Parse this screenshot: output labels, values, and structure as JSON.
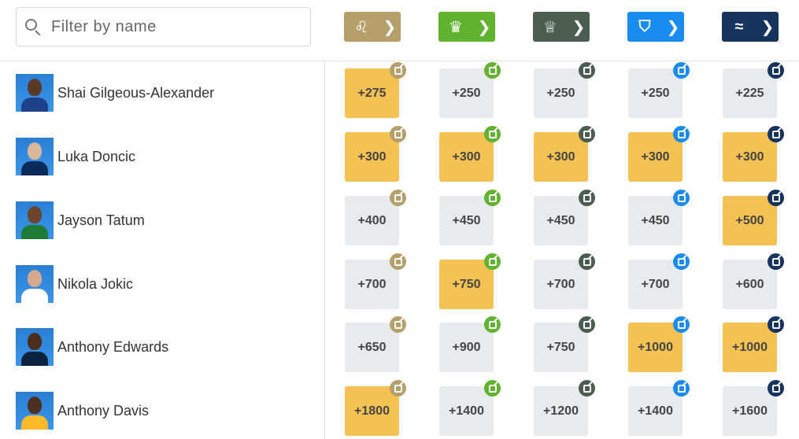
{
  "search": {
    "placeholder": "Filter by name",
    "value": ""
  },
  "books": [
    {
      "id": "betmgm",
      "color": "#b59f6b",
      "logo_icon": "lion-icon",
      "glyph": "♌"
    },
    {
      "id": "draftkings",
      "color": "#61b22e",
      "logo_icon": "crown-icon",
      "glyph": "♛"
    },
    {
      "id": "caesars",
      "color": "#4b5d50",
      "logo_icon": "trophy-icon",
      "glyph": "♕"
    },
    {
      "id": "fanduel",
      "color": "#1a8cf0",
      "logo_icon": "shield-icon",
      "glyph": "⛉"
    },
    {
      "id": "betrivers",
      "color": "#17345f",
      "logo_icon": "betrivers-logo-icon",
      "glyph": "≈"
    }
  ],
  "chevron": "❯",
  "players": [
    {
      "name": "Shai Gilgeous-Alexander",
      "odds": [
        "+275",
        "+250",
        "+250",
        "+250",
        "+225"
      ],
      "best": [
        true,
        false,
        false,
        false,
        false
      ],
      "skin": "#5a3a27",
      "jersey": "#1d428a"
    },
    {
      "name": "Luka Doncic",
      "odds": [
        "+300",
        "+300",
        "+300",
        "+300",
        "+300"
      ],
      "best": [
        true,
        true,
        true,
        true,
        true
      ],
      "skin": "#d9b59c",
      "jersey": "#0b2a5a"
    },
    {
      "name": "Jayson Tatum",
      "odds": [
        "+400",
        "+450",
        "+450",
        "+450",
        "+500"
      ],
      "best": [
        false,
        false,
        false,
        false,
        true
      ],
      "skin": "#6b4530",
      "jersey": "#1f7a3a"
    },
    {
      "name": "Nikola Jokic",
      "odds": [
        "+700",
        "+750",
        "+700",
        "+700",
        "+600"
      ],
      "best": [
        false,
        true,
        false,
        false,
        false
      ],
      "skin": "#d4a98e",
      "jersey": "#ffffff"
    },
    {
      "name": "Anthony Edwards",
      "odds": [
        "+650",
        "+900",
        "+750",
        "+1000",
        "+1000"
      ],
      "best": [
        false,
        false,
        false,
        true,
        true
      ],
      "skin": "#4a2e1f",
      "jersey": "#0c2340"
    },
    {
      "name": "Anthony Davis",
      "odds": [
        "+1800",
        "+1400",
        "+1200",
        "+1400",
        "+1600"
      ],
      "best": [
        true,
        false,
        false,
        false,
        false
      ],
      "skin": "#4b2f20",
      "jersey": "#fdb927"
    }
  ]
}
